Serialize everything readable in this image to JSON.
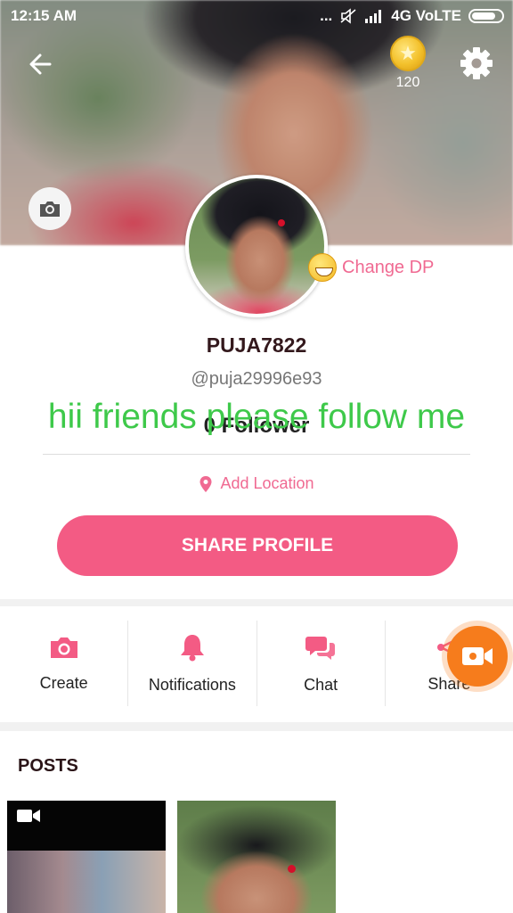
{
  "status_bar": {
    "time": "12:15 AM",
    "network": "4G VoLTE",
    "signal_dots": "..."
  },
  "header": {
    "coin_count": "120"
  },
  "profile": {
    "change_dp_label": "Change DP",
    "username": "PUJA7822",
    "handle": "@puja29996e93",
    "followers": "0 Follower",
    "location_label": "Add Location",
    "share_button_label": "SHARE PROFILE"
  },
  "overlay": {
    "caption": "hii friends please follow me"
  },
  "actions": [
    {
      "label": "Create",
      "icon": "camera-icon"
    },
    {
      "label": "Notifications",
      "icon": "bell-icon"
    },
    {
      "label": "Chat",
      "icon": "chat-bubbles-icon"
    },
    {
      "label": "Share",
      "icon": "share-icon"
    }
  ],
  "posts": {
    "title": "POSTS"
  },
  "colors": {
    "accent_pink": "#f35b84",
    "caption_green": "#3ec94a",
    "fab_orange": "#f67c1c"
  }
}
